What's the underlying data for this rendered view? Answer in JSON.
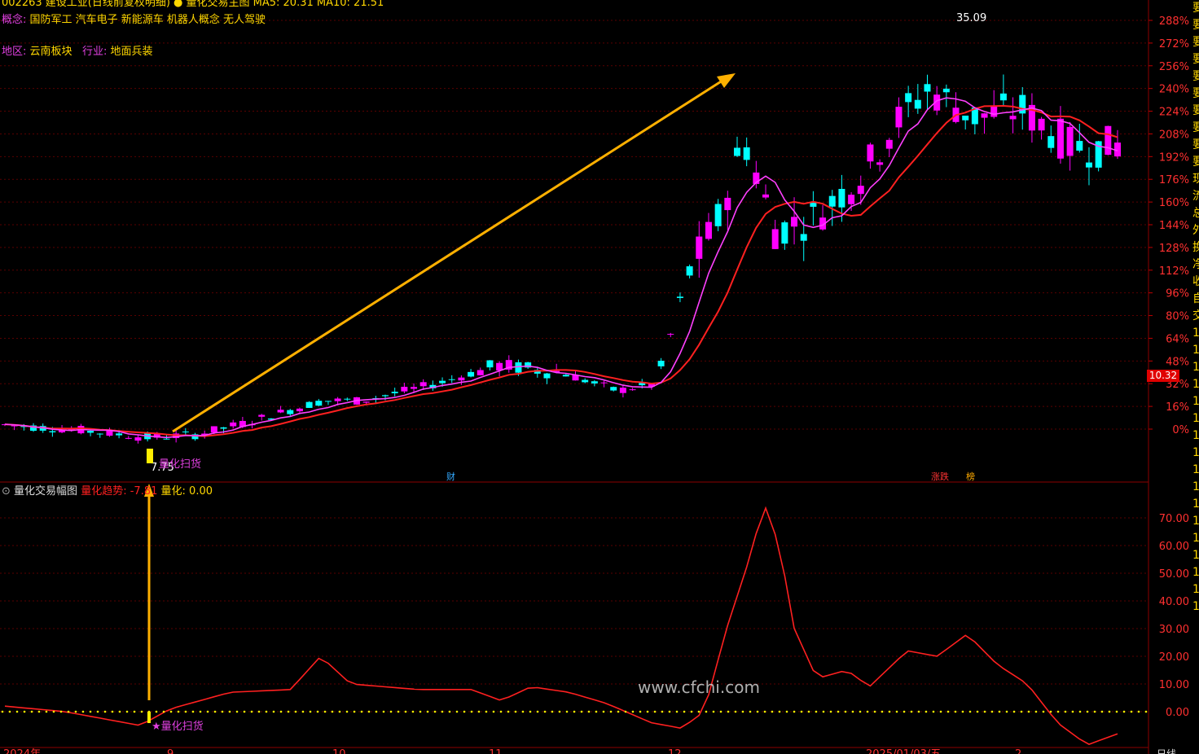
{
  "header": {
    "top_line": "002263 建设工业(日线前复权明细) ● 量化交易主图 MA5: 20.31 MA10: 21.51",
    "concept_label": "概念:",
    "concepts": "国防军工 汽车电子 新能源车 机器人概念 无人驾驶",
    "region_label": "地区:",
    "region": "云南板块",
    "industry_label": "行业:",
    "industry": "地面兵装"
  },
  "main_chart": {
    "y_axis_labels": [
      "288%",
      "272%",
      "256%",
      "240%",
      "224%",
      "208%",
      "192%",
      "176%",
      "160%",
      "144%",
      "128%",
      "112%",
      "96%",
      "80%",
      "64%",
      "48%",
      "32%",
      "16%",
      "0%"
    ],
    "current_price": "10.32",
    "high_label": "35.09",
    "low_label": "7.75",
    "signal_label": "量化扫货",
    "event_tags": [
      "财",
      "涨跌",
      "榜"
    ]
  },
  "indicator": {
    "title": "量化交易幅图",
    "trend_label": "量化趋势:",
    "trend_value": "-7.81",
    "quant_label": "量化:",
    "quant_value": "0.00",
    "y_axis_labels": [
      "70.00",
      "60.00",
      "50.00",
      "40.00",
      "30.00",
      "20.00",
      "10.00",
      "0.00"
    ],
    "signal_label": "量化扫货"
  },
  "x_axis": {
    "labels": [
      "2024年",
      "9",
      "10",
      "11",
      "12",
      "2025/01/03/五",
      "2"
    ],
    "right_label": "日线"
  },
  "watermark": "www.cfchi.com",
  "side_text": [
    "要",
    "要",
    "要",
    "要",
    "要",
    "要",
    "要",
    "要",
    "要",
    "要",
    "现",
    "流",
    "总",
    "外",
    "换",
    "净",
    "收",
    "自",
    "交",
    "1",
    "1",
    "1",
    "1",
    "1",
    "1",
    "1",
    "1",
    "1",
    "1",
    "1",
    "1",
    "1",
    "1",
    "1",
    "1",
    "1"
  ],
  "colors": {
    "up_candle": "#ff00ff",
    "down_candle": "#00ffff",
    "ma5": "#ff40ff",
    "ma10": "#ff2020",
    "grid": "#5a0000",
    "arrow": "#ffb000",
    "indicator_line": "#ff2020",
    "zero_dots": "#ffff00"
  }
}
